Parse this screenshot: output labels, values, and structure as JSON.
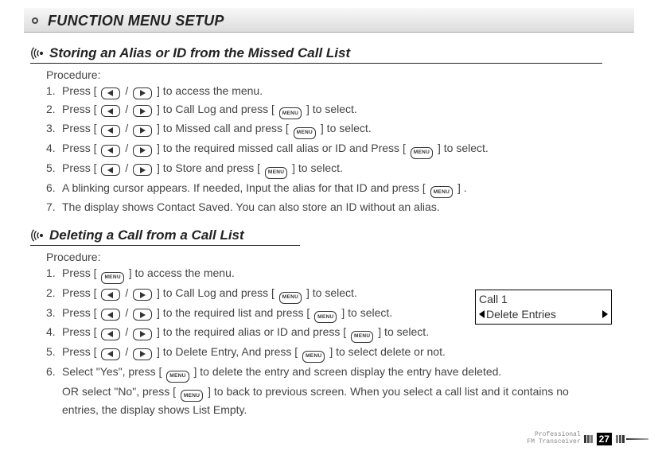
{
  "main_title": "FUNCTION MENU SETUP",
  "section1": {
    "title": "Storing an Alias or ID from the Missed Call List",
    "procedure_label": "Procedure:",
    "steps": {
      "s1": {
        "a": "Press [ ",
        "b": " / ",
        "c": " ] to access the menu."
      },
      "s2": {
        "a": "Press [ ",
        "b": " / ",
        "c": " ] to Call Log and press [ ",
        "d": " ] to select."
      },
      "s3": {
        "a": "Press [ ",
        "b": " / ",
        "c": " ] to Missed call and press [ ",
        "d": " ] to select."
      },
      "s4": {
        "a": "Press [ ",
        "b": " / ",
        "c": " ] to the required missed call alias or ID and Press [ ",
        "d": " ] to select."
      },
      "s5": {
        "a": "Press [ ",
        "b": " / ",
        "c": " ] to Store and press [ ",
        "d": " ] to select."
      },
      "s6": {
        "a": "A blinking cursor appears. If needed, Input the alias for that ID and press [ ",
        "b": " ] ."
      },
      "s7": {
        "a": "The display shows Contact Saved. You can also store an ID without an alias."
      }
    }
  },
  "section2": {
    "title": "Deleting a Call from a Call List",
    "procedure_label": "Procedure:",
    "steps": {
      "s1": {
        "a": "Press [ ",
        "b": " ] to access the menu."
      },
      "s2": {
        "a": "Press [ ",
        "b": " / ",
        "c": " ] to Call Log and press [ ",
        "d": " ] to select."
      },
      "s3": {
        "a": " Press [ ",
        "b": " / ",
        "c": " ] to the required list and press [ ",
        "d": " ] to select."
      },
      "s4": {
        "a": "Press [ ",
        "b": " / ",
        "c": " ] to the required alias or ID and press [ ",
        "d": " ] to select."
      },
      "s5": {
        "a": "Press [ ",
        "b": " / ",
        "c": " ] to Delete Entry, And press [ ",
        "d": " ]  to select delete or not."
      },
      "s6": {
        "a": "Select \"Yes\", press [ ",
        "b": " ] to  delete the entry and screen display the entry have deleted."
      },
      "cont": "OR select \"No\", press [ ",
      "cont2": " ] to back to previous screen. When you select a call list and it contains no entries, the display shows List Empty."
    }
  },
  "callout": {
    "line1": "Call 1",
    "line2": "Delete Entries"
  },
  "key_menu_label": "MENU",
  "footer": {
    "line1": "Professional",
    "line2": "FM Transceiver",
    "page": "27"
  }
}
